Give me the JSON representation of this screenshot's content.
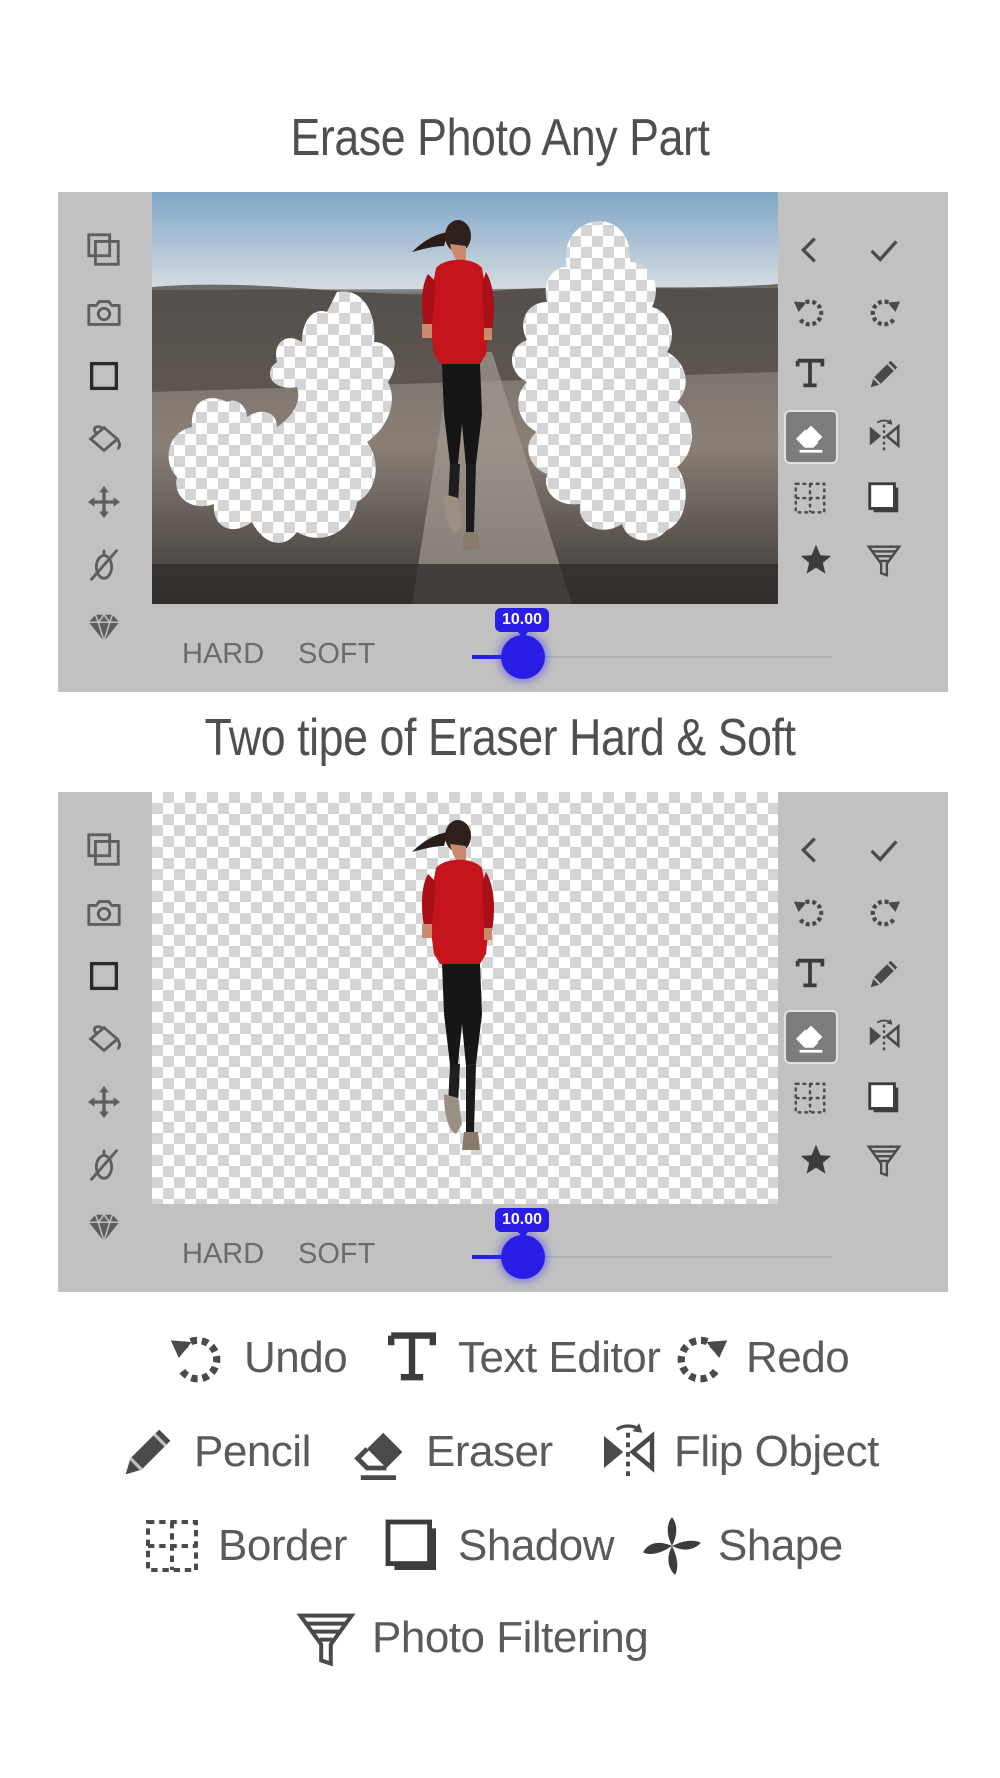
{
  "headings": {
    "top": "Erase Photo Any Part",
    "middle": "Two tipe of Eraser Hard & Soft"
  },
  "left_tools": [
    "layers-icon",
    "camera-icon",
    "square-icon",
    "paint-bucket-icon",
    "move-icon",
    "no-brush-icon",
    "diamond-icon"
  ],
  "right_tools": [
    [
      "back-icon",
      "check-icon"
    ],
    [
      "undo-icon",
      "redo-icon"
    ],
    [
      "text-icon",
      "pencil-icon"
    ],
    [
      "eraser-icon",
      "flip-icon"
    ],
    [
      "border-icon",
      "shadow-icon"
    ],
    [
      "star-icon",
      "filter-icon"
    ]
  ],
  "eraser_bar": {
    "hard_label": "HARD",
    "soft_label": "SOFT",
    "value": "10.00",
    "slider_fraction": 0.14
  },
  "legend": {
    "undo": "Undo",
    "text_editor": "Text Editor",
    "redo": "Redo",
    "pencil": "Pencil",
    "eraser": "Eraser",
    "flip_object": "Flip Object",
    "border": "Border",
    "shadow": "Shadow",
    "shape": "Shape",
    "photo_filtering": "Photo Filtering"
  },
  "colors": {
    "panel": "#c1c1c1",
    "accent": "#2a1ee6",
    "icon": "#606060"
  }
}
